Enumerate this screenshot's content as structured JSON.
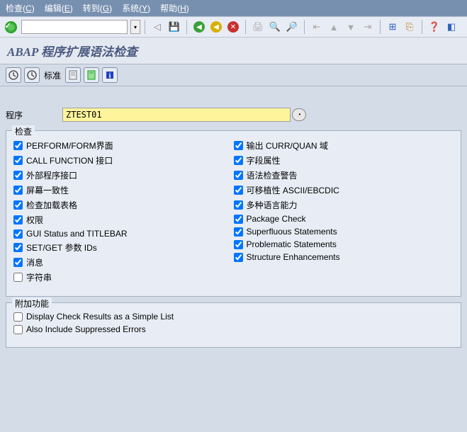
{
  "menubar": {
    "items": [
      {
        "label": "检查",
        "key": "C"
      },
      {
        "label": "编辑",
        "key": "E"
      },
      {
        "label": "转到",
        "key": "G"
      },
      {
        "label": "系统",
        "key": "Y"
      },
      {
        "label": "帮助",
        "key": "H"
      }
    ]
  },
  "title": "ABAP 程序扩展语法检查",
  "subtoolbar": {
    "standard_label": "标准"
  },
  "program": {
    "label": "程序",
    "value": "ZTEST01"
  },
  "groups": {
    "check": {
      "title": "检查",
      "left": [
        {
          "label": "PERFORM/FORM界面",
          "checked": true
        },
        {
          "label": "CALL FUNCTION 接口",
          "checked": true
        },
        {
          "label": "外部程序接口",
          "checked": true
        },
        {
          "label": "屏幕一致性",
          "checked": true
        },
        {
          "label": "检查加载表格",
          "checked": true
        },
        {
          "label": "权限",
          "checked": true
        },
        {
          "label": "GUI Status and TITLEBAR",
          "checked": true
        },
        {
          "label": "SET/GET  参数 IDs",
          "checked": true
        },
        {
          "label": "消息",
          "checked": true
        },
        {
          "label": "字符串",
          "checked": false
        }
      ],
      "right": [
        {
          "label": "输出 CURR/QUAN 域",
          "checked": true
        },
        {
          "label": "字段属性",
          "checked": true
        },
        {
          "label": "语法检查警告",
          "checked": true
        },
        {
          "label": "可移植性 ASCII/EBCDIC",
          "checked": true
        },
        {
          "label": "多种语言能力",
          "checked": true
        },
        {
          "label": "Package Check",
          "checked": true
        },
        {
          "label": "Superfluous Statements",
          "checked": true
        },
        {
          "label": "Problematic Statements",
          "checked": true
        },
        {
          "label": "Structure Enhancements",
          "checked": true
        }
      ]
    },
    "extra": {
      "title": "附加功能",
      "items": [
        {
          "label": "Display Check Results as a Simple List",
          "checked": false
        },
        {
          "label": "Also Include Suppressed Errors",
          "checked": false
        }
      ]
    }
  }
}
